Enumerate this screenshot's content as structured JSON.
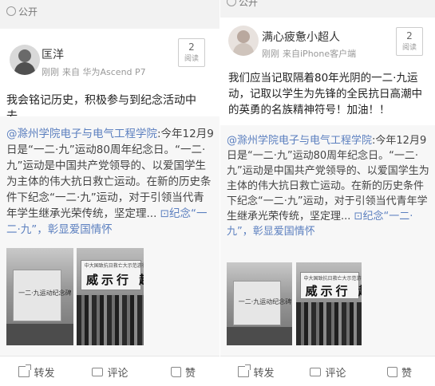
{
  "privacy_label": "公开",
  "posts": [
    {
      "username": "匡洋",
      "time": "刚刚",
      "source": "来自 华为Ascend P7",
      "read_count": "2",
      "read_label": "阅读",
      "text": "我会铭记历史，积极参与到纪念活动中去。",
      "quoted": {
        "mention": "@滁州学院电子与电气工程学院",
        "body": ":今年12月9日是“一二·九”运动80周年纪念日。“一二·九”运动是中国共产党领导的、以爱国学生为主体的伟大抗日救亡运动。在新的历史条件下纪念“一二·九”运动，对于引领当代青年学生继承光荣传统，坚定理...",
        "link": "纪念“一二·九”，彰显爱国情怀"
      }
    },
    {
      "username": "满心疲惫小超人",
      "time": "刚刚",
      "source": "来自iPhone客户端",
      "read_count": "2",
      "read_label": "阅读",
      "text": "我们应当记取隔着80年光阴的一二·九运动，记取以学生为先锋的全民抗日高潮中的英勇的名族精神符号！加油！！",
      "quoted": {
        "mention": "@滁州学院电子与电气工程学院",
        "body": ":今年12月9日是“一二·九”运动80周年纪念日。“一二·九”运动是中国共产党领导的、以爱国学生为主体的伟大抗日救亡运动。在新的历史条件下纪念“一二·九”运动，对于引领当代青年学生继承光荣传统，坚定理...",
        "link": "纪念“一二·九”，彰显爱国情怀"
      }
    }
  ],
  "photo_text": {
    "monument_inscription": "一二·九运动纪念碑",
    "banner_small": "中大国致抗日救亡大示范游行",
    "banner_big": "威示行 趣"
  },
  "actions": {
    "repost": "转发",
    "comment": "评论",
    "like": "赞"
  },
  "icons": [
    "globe-icon",
    "repost-icon",
    "comment-icon",
    "like-icon",
    "link-icon"
  ]
}
